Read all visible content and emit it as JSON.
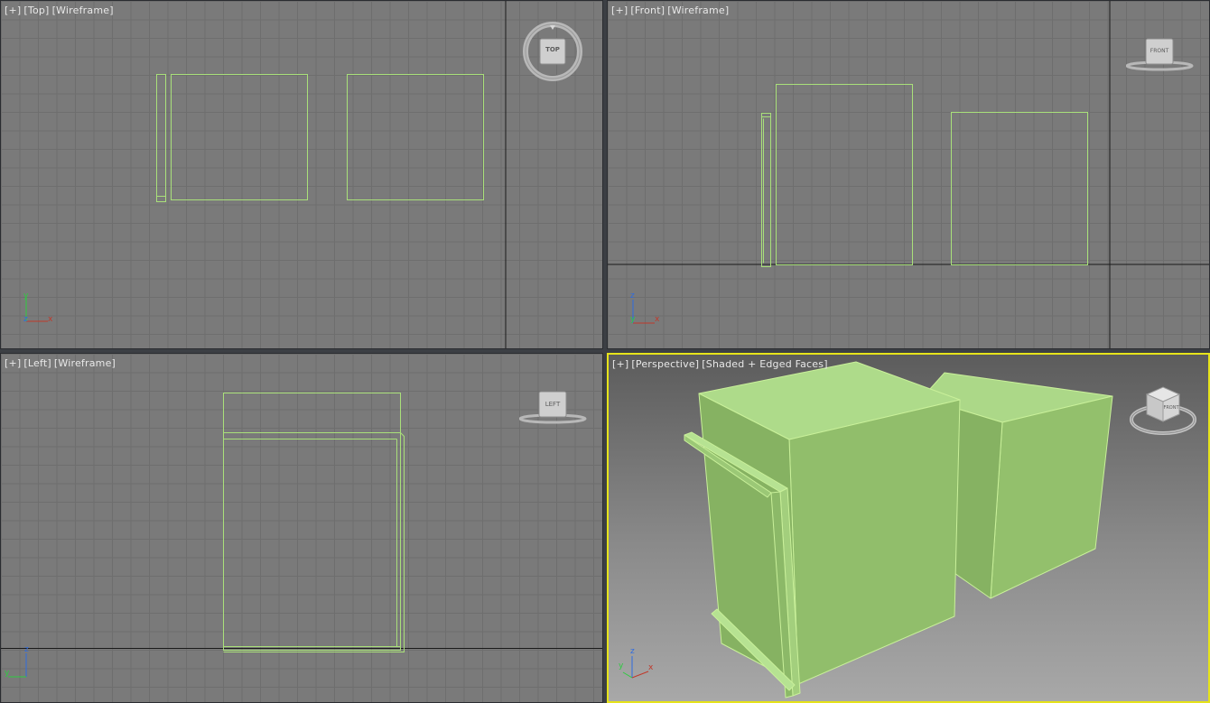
{
  "viewports": {
    "top": {
      "menu": "[+]",
      "view": "[Top]",
      "mode": "[Wireframe]",
      "navcube_label": "TOP",
      "axes": {
        "a": "y",
        "b": "z",
        "c": "x"
      }
    },
    "front": {
      "menu": "[+]",
      "view": "[Front]",
      "mode": "[Wireframe]",
      "navcube_label": "FRONT",
      "axes": {
        "a": "z",
        "b": "y",
        "c": "x"
      }
    },
    "left": {
      "menu": "[+]",
      "view": "[Left]",
      "mode": "[Wireframe]",
      "navcube_label": "LEFT",
      "axes": {
        "a": "z",
        "b": "y",
        "c": "x"
      }
    },
    "perspective": {
      "menu": "[+]",
      "view": "[Perspective]",
      "mode": "[Shaded + Edged Faces]",
      "navcube_label": "FRONT",
      "axes": {
        "a": "z",
        "b": "y",
        "c": "x"
      }
    }
  },
  "colors": {
    "wire": "#a9e07a",
    "mesh_light": "#a9d882",
    "mesh_mid": "#8fbd6a",
    "mesh_dark": "#83b060",
    "active_border": "#e6e31a",
    "axis_x": "#c0392b",
    "axis_y": "#2ecc40",
    "axis_z": "#2f6ce0"
  }
}
